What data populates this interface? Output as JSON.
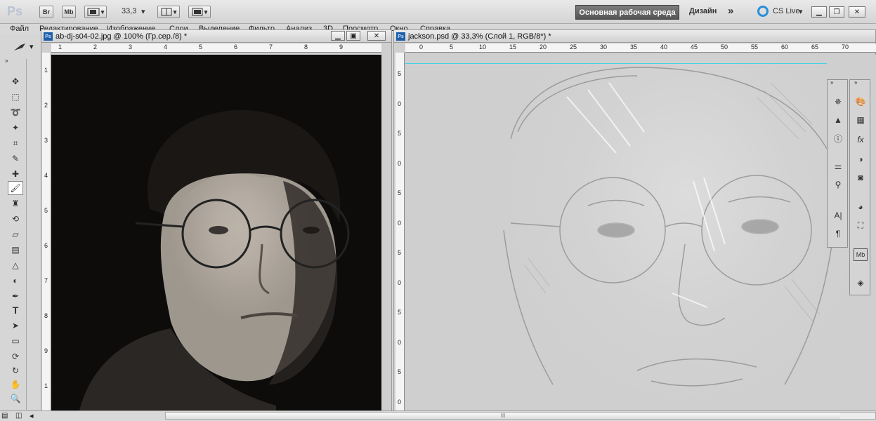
{
  "app": {
    "logo": "Ps",
    "bridge_label": "Br",
    "minibridge_label": "Mb",
    "zoom": "33,3",
    "workspace_label": "Основная рабочая среда",
    "design_label": "Дизайн",
    "more_label": "»",
    "cslive_label": "CS Live"
  },
  "menu": {
    "items": [
      "Файл",
      "Редактирование",
      "Изображение",
      "Слои",
      "Выделение",
      "Фильтр",
      "Анализ",
      "3D",
      "Просмотр",
      "Окно",
      "Справка"
    ]
  },
  "documents": [
    {
      "title": "ab-dj-s04-02.jpg @ 100% (Гр.сер./8) *",
      "ruler_h": [
        "1",
        "2",
        "3",
        "4",
        "5",
        "6",
        "7",
        "8",
        "9"
      ],
      "ruler_v": [
        "1",
        "2",
        "3",
        "4",
        "5",
        "6",
        "7",
        "8",
        "9",
        "1"
      ]
    },
    {
      "title": "jackson.psd @ 33,3% (Слой 1, RGB/8*) *",
      "ruler_h": [
        "0",
        "5",
        "10",
        "15",
        "20",
        "25",
        "30",
        "35",
        "40",
        "45",
        "50",
        "55",
        "60",
        "65",
        "70"
      ],
      "ruler_v": [
        "5",
        "0",
        "5",
        "0",
        "5",
        "0",
        "5",
        "0",
        "5",
        "0",
        "5",
        "0",
        "5",
        "0"
      ]
    }
  ],
  "colors": {
    "guide": "#43d3e3",
    "workspace_button": "#5f5f5f",
    "ps_icon": "#1f5fa8"
  },
  "scrollbar": {
    "grip": "III"
  }
}
